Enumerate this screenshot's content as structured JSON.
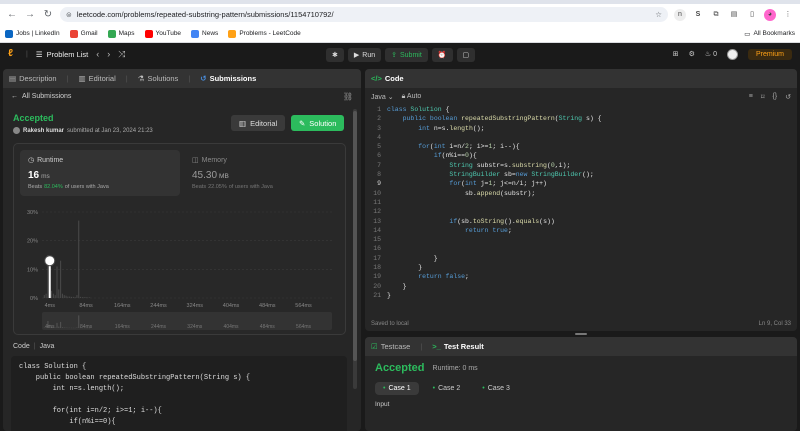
{
  "browser": {
    "url": "leetcode.com/problems/repeated-substring-pattern/submissions/1154710792/",
    "profile_initials": [
      "n",
      "S"
    ],
    "bookmarks": [
      {
        "label": "Jobs | LinkedIn",
        "color": "#0a66c2"
      },
      {
        "label": "Gmail",
        "color": "#ea4335"
      },
      {
        "label": "Maps",
        "color": "#34a853"
      },
      {
        "label": "YouTube",
        "color": "#ff0000"
      },
      {
        "label": "News",
        "color": "#4285f4"
      },
      {
        "label": "Problems - LeetCode",
        "color": "#ffa116"
      }
    ],
    "all_bookmarks": "All Bookmarks"
  },
  "lcnav": {
    "problem_list": "Problem List",
    "run": "Run",
    "submit": "Submit",
    "streak": "0",
    "premium": "Premium"
  },
  "left": {
    "tabs": [
      "Description",
      "Editorial",
      "Solutions",
      "Submissions"
    ],
    "all_submissions": "All Submissions",
    "status": "Accepted",
    "author": "Rakesh kumar",
    "submitted_text": "submitted at Jan 23, 2024 21:23",
    "editorial_btn": "Editorial",
    "solution_btn": "Solution",
    "runtime": {
      "title": "Runtime",
      "value": "16",
      "unit": "ms",
      "beats_label": "Beats",
      "beats_pct": "82.04%",
      "beats_suffix": "of users with Java"
    },
    "memory": {
      "title": "Memory",
      "value": "45.30",
      "unit": "MB",
      "beats_label": "Beats",
      "beats_pct": "22.05%",
      "beats_suffix": "of users with Java"
    },
    "code_label": "Code",
    "code_lang": "Java",
    "code_preview": "class Solution {\n    public boolean repeatedSubstringPattern(String s) {\n        int n=s.length();\n\n        for(int i=n/2; i>=1; i--){\n            if(n%i==0){"
  },
  "chart_data": {
    "type": "bar",
    "x_ticks": [
      "4ms",
      "84ms",
      "164ms",
      "244ms",
      "324ms",
      "404ms",
      "484ms",
      "564ms"
    ],
    "y_ticks": [
      "0%",
      "10%",
      "20%",
      "30%"
    ],
    "ylim": [
      0,
      30
    ],
    "xlim": [
      0,
      640
    ],
    "bar_width_ms": 4,
    "bars": [
      {
        "x": 4,
        "y": 1
      },
      {
        "x": 8,
        "y": 1.5
      },
      {
        "x": 12,
        "y": 15
      },
      {
        "x": 16,
        "y": 7
      },
      {
        "x": 20,
        "y": 2.5
      },
      {
        "x": 24,
        "y": 1.5
      },
      {
        "x": 28,
        "y": 1
      },
      {
        "x": 32,
        "y": 11
      },
      {
        "x": 36,
        "y": 3
      },
      {
        "x": 40,
        "y": 13
      },
      {
        "x": 44,
        "y": 1.5
      },
      {
        "x": 48,
        "y": 1
      },
      {
        "x": 52,
        "y": 0.8
      },
      {
        "x": 56,
        "y": 0.5
      },
      {
        "x": 60,
        "y": 0.5
      },
      {
        "x": 64,
        "y": 0.4
      },
      {
        "x": 68,
        "y": 0.4
      },
      {
        "x": 72,
        "y": 0.3
      },
      {
        "x": 76,
        "y": 1
      },
      {
        "x": 80,
        "y": 27
      },
      {
        "x": 84,
        "y": 0.4
      },
      {
        "x": 88,
        "y": 0.3
      },
      {
        "x": 92,
        "y": 0.3
      },
      {
        "x": 96,
        "y": 0.3
      },
      {
        "x": 100,
        "y": 0.2
      },
      {
        "x": 104,
        "y": 0.2
      }
    ],
    "highlight": {
      "x": 16,
      "y": 13
    },
    "grid": true
  },
  "editor": {
    "tab_title": "Code",
    "language": "Java",
    "mode": "Auto",
    "saved": "Saved to local",
    "cursor": "Ln 9, Col 33",
    "current_line": 9
  },
  "bottom": {
    "tabs": [
      "Testcase",
      "Test Result"
    ],
    "status": "Accepted",
    "runtime": "Runtime: 0 ms",
    "cases": [
      "Case 1",
      "Case 2",
      "Case 3"
    ],
    "input_label": "Input"
  }
}
